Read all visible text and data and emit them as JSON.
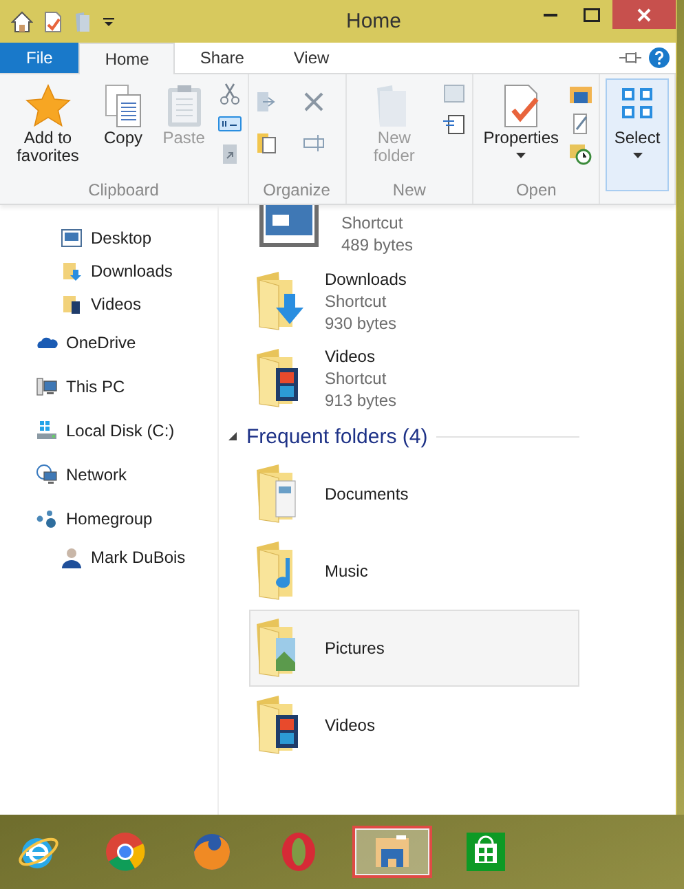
{
  "window": {
    "title": "Home"
  },
  "ribbon_tabs": [
    {
      "label": "File",
      "kind": "file",
      "selected": false
    },
    {
      "label": "Home",
      "kind": "tab",
      "selected": true
    },
    {
      "label": "Share",
      "kind": "tab",
      "selected": false
    },
    {
      "label": "View",
      "kind": "tab",
      "selected": false
    }
  ],
  "ribbon_groups": [
    {
      "label": "Clipboard",
      "commands": [
        {
          "label": "Add to favorites",
          "kind": "star",
          "disabled": false,
          "highlighted": false
        },
        {
          "label": "Copy",
          "kind": "copy",
          "disabled": false,
          "highlighted": false
        },
        {
          "label": "Paste",
          "kind": "paste",
          "disabled": true,
          "highlighted": false
        }
      ]
    },
    {
      "label": "Organize"
    },
    {
      "label": "New",
      "commands": [
        {
          "label": "New folder",
          "kind": "folder",
          "disabled": true,
          "highlighted": false
        }
      ]
    },
    {
      "label": "Open",
      "commands": [
        {
          "label": "Properties",
          "kind": "properties",
          "disabled": false,
          "highlighted": false
        }
      ]
    },
    {
      "commands": [
        {
          "label": "Select",
          "kind": "select",
          "disabled": false,
          "highlighted": true
        }
      ]
    }
  ],
  "navigation": [
    {
      "children": [
        {
          "label": "Desktop",
          "kind": "desktop"
        },
        {
          "label": "Downloads",
          "kind": "downloads"
        },
        {
          "label": "Videos",
          "kind": "videos"
        }
      ]
    },
    {
      "label": "OneDrive",
      "kind": "cloud"
    },
    {
      "label": "This PC",
      "kind": "pc"
    },
    {
      "label": "Local Disk (C:)",
      "kind": "drive"
    },
    {
      "label": "Network",
      "kind": "network"
    },
    {
      "label": "Homegroup",
      "kind": "homegroup",
      "children": [
        {
          "label": "Mark DuBois",
          "kind": "user"
        }
      ]
    }
  ],
  "favorites": [
    {
      "kind": "desktop",
      "type": "Shortcut",
      "size": "489 bytes"
    },
    {
      "name": "Downloads",
      "kind": "downloads",
      "type": "Shortcut",
      "size": "930 bytes"
    },
    {
      "name": "Videos",
      "kind": "videos",
      "type": "Shortcut",
      "size": "913 bytes"
    }
  ],
  "frequent_folders": {
    "title": "Frequent folders (4)",
    "expanded": true,
    "items": [
      {
        "name": "Documents",
        "kind": "documents",
        "selected": false
      },
      {
        "name": "Music",
        "kind": "music",
        "selected": false
      },
      {
        "name": "Pictures",
        "kind": "pictures",
        "selected": true
      },
      {
        "name": "Videos",
        "kind": "videos",
        "selected": false
      }
    ]
  },
  "taskbar": [
    {
      "kind": "ie",
      "active": false
    },
    {
      "kind": "chrome",
      "active": false
    },
    {
      "kind": "firefox",
      "active": false
    },
    {
      "kind": "opera",
      "active": false
    },
    {
      "kind": "explorer",
      "active": true
    },
    {
      "kind": "store",
      "active": false
    }
  ]
}
